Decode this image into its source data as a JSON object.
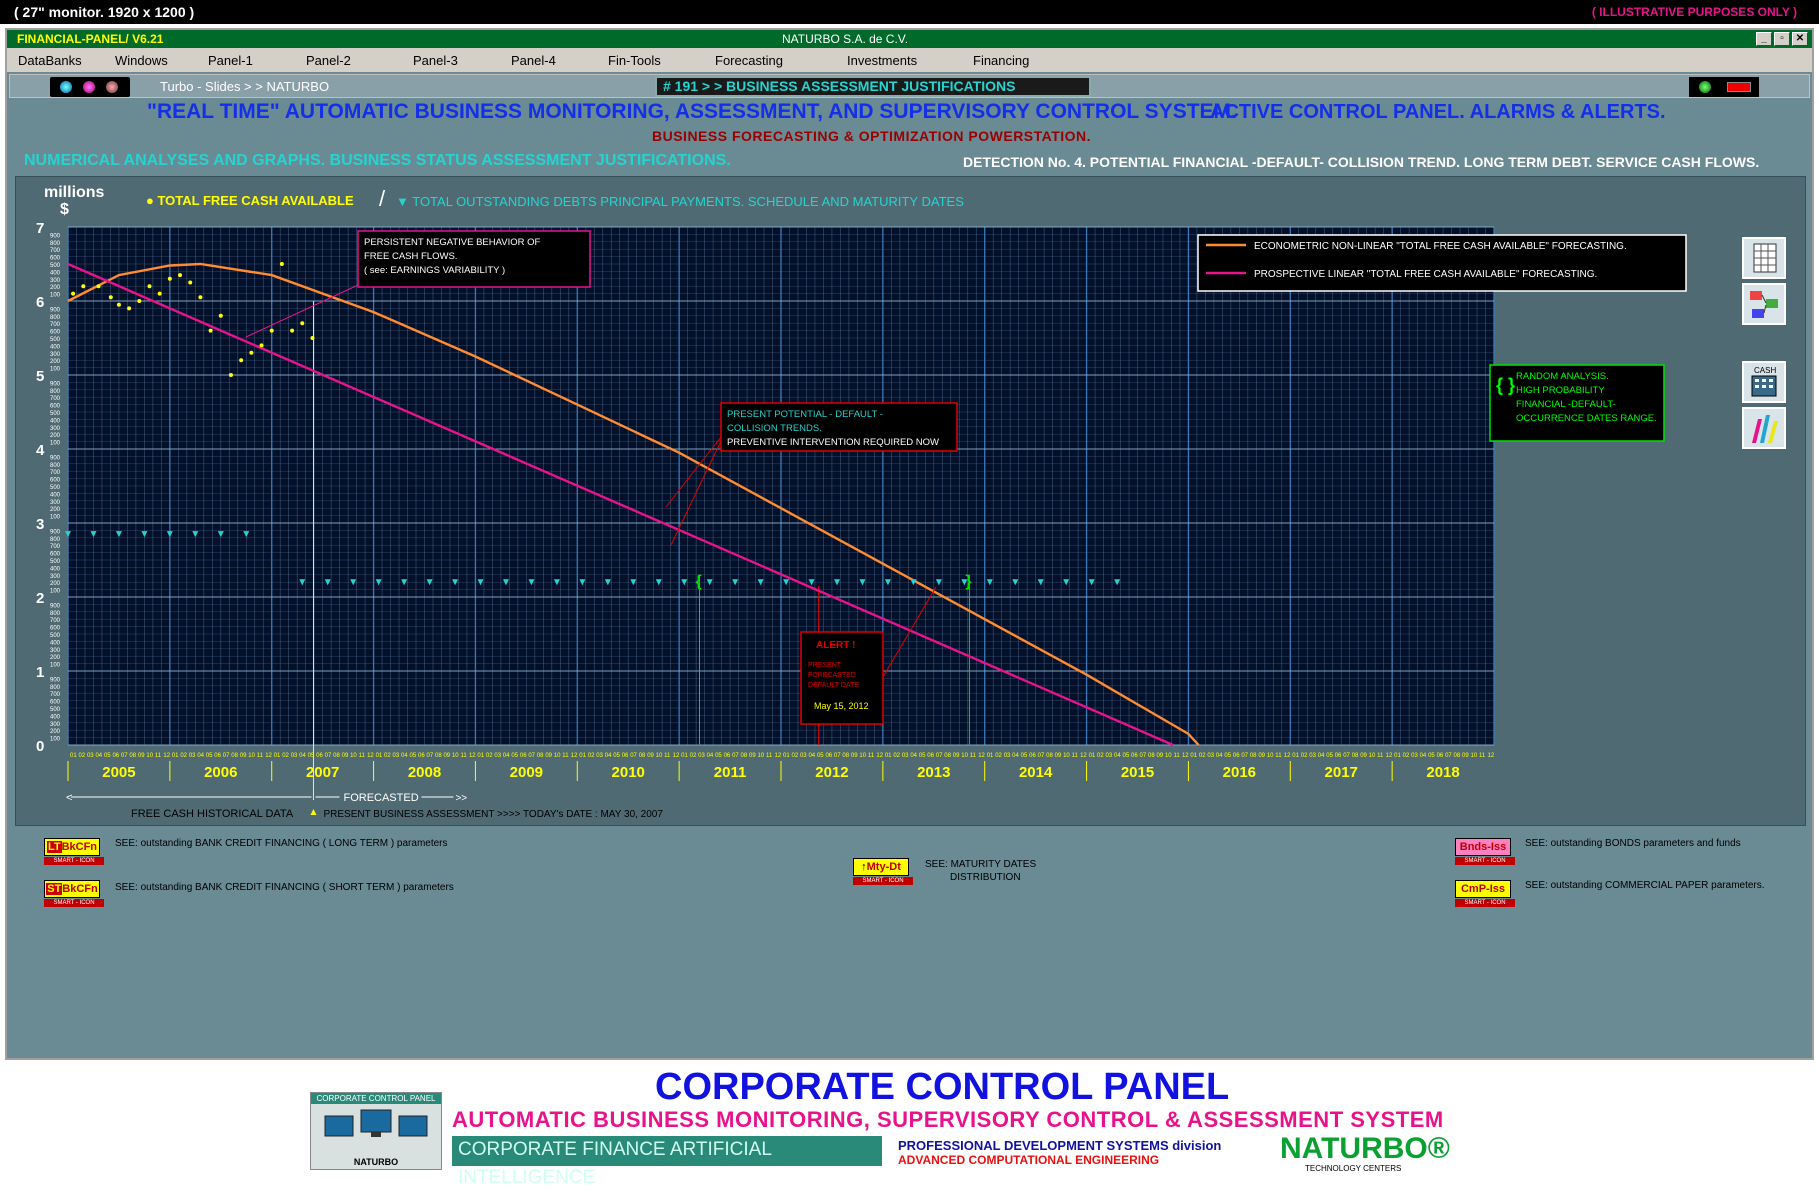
{
  "monitor": "( 27\" monitor.  1920 x 1200 )",
  "illustrative": "( ILLUSTRATIVE  PURPOSES  ONLY )",
  "app_title": "FINANCIAL-PANEL/ V6.21",
  "company": "NATURBO S.A.  de  C.V.",
  "menu": [
    "DataBanks",
    "Windows",
    "Panel-1",
    "Panel-2",
    "Panel-3",
    "Panel-4",
    "Fin-Tools",
    "Forecasting",
    "Investments",
    "Financing"
  ],
  "breadcrumb": "Turbo - Slides > > NATURBO",
  "slide_header": "# 191 > > BUSINESS ASSESSMENT JUSTIFICATIONS",
  "headline": "\"REAL TIME\"  AUTOMATIC  BUSINESS  MONITORING, ASSESSMENT, AND  SUPERVISORY  CONTROL  SYSTEM.",
  "headline2": "ACTIVE CONTROL PANEL.   ALARMS  &  ALERTS.",
  "subheadline": "BUSINESS  FORECASTING  &  OPTIMIZATION  POWERSTATION.",
  "section_left": "NUMERICAL ANALYSES AND GRAPHS.   BUSINESS STATUS ASSESSMENT JUSTIFICATIONS.",
  "section_right": "DETECTION No. 4.  POTENTIAL  FINANCIAL  -DEFAULT-  COLLISION TREND.  LONG TERM DEBT.  SERVICE CASH FLOWS.",
  "chart_labels": {
    "y_unit1": "millions",
    "y_unit2": "$",
    "legend1": "●  TOTAL  FREE  CASH  AVAILABLE",
    "legend2": "▼ TOTAL OUTSTANDING  DEBTS PRINCIPAL PAYMENTS.  SCHEDULE AND MATURITY DATES",
    "box_legend_orange": "ECONOMETRIC NON-LINEAR  \"TOTAL FREE CASH AVAILABLE\"  FORECASTING.",
    "box_legend_magenta": "PROSPECTIVE LINEAR  \"TOTAL FREE CASH AVAILABLE\"  FORECASTING.",
    "annot_negative": [
      "PERSISTENT NEGATIVE BEHAVIOR OF",
      "FREE  CASH  FLOWS.",
      "( see:  EARNINGS VARIABILITY )"
    ],
    "annot_collision": [
      "PRESENT  POTENTIAL  - DEFAULT -",
      "COLLISION  TRENDS.",
      "PREVENTIVE  INTERVENTION  REQUIRED  NOW"
    ],
    "annot_random": [
      "RANDOM  ANALYSIS.",
      "HIGH  PROBABILITY",
      "FINANCIAL  -DEFAULT-",
      "OCCURRENCE  DATES  RANGE."
    ],
    "annot_alert": [
      "ALERT   !",
      "PRESENT",
      "FORECASTED",
      "DEFAULT  DATE",
      "May 15, 2012"
    ],
    "hist_label": "FREE CASH HISTORICAL DATA",
    "forecast_label": "FORECASTED",
    "today_label": "PRESENT  BUSINESS  ASSESSMENT >>>> TODAY's  DATE :  MAY 30, 2007"
  },
  "chart_data": {
    "type": "line",
    "ylim": [
      0,
      7
    ],
    "y_ticks": [
      "0",
      "1",
      "2",
      "3",
      "4",
      "5",
      "6",
      "7"
    ],
    "years": [
      "2005",
      "2006",
      "2007",
      "2008",
      "2009",
      "2010",
      "2011",
      "2012",
      "2013",
      "2014",
      "2015",
      "2016",
      "2017",
      "2018"
    ],
    "series": [
      {
        "name": "ECONOMETRIC NON-LINEAR  \"TOTAL FREE CASH AVAILABLE\"  FORECASTING.",
        "color": "#ff8c32",
        "x": [
          2005.0,
          2005.5,
          2006.0,
          2006.3,
          2007.0,
          2008.0,
          2009.0,
          2010.0,
          2011.0,
          2012.0,
          2013.0,
          2014.0,
          2015.0,
          2016.0,
          2016.1
        ],
        "values": [
          6.0,
          6.35,
          6.48,
          6.5,
          6.35,
          5.85,
          5.25,
          4.6,
          3.95,
          3.2,
          2.45,
          1.7,
          0.95,
          0.15,
          0.0
        ]
      },
      {
        "name": "PROSPECTIVE LINEAR  \"TOTAL FREE CASH AVAILABLE\"  FORECASTING.",
        "color": "#e8138c",
        "x": [
          2005.0,
          2015.85
        ],
        "values": [
          6.5,
          0.0
        ]
      },
      {
        "name": "TOTAL FREE CASH AVAILABLE",
        "color": "#ffff00",
        "x": [
          2005.05,
          2005.15,
          2005.3,
          2005.42,
          2005.5,
          2005.6,
          2005.7,
          2005.8,
          2005.9,
          2006.0,
          2006.1,
          2006.2,
          2006.3,
          2006.4,
          2006.5,
          2006.6,
          2006.7,
          2006.8,
          2006.9,
          2007.0,
          2007.1,
          2007.2,
          2007.3,
          2007.4
        ],
        "values": [
          6.1,
          6.2,
          6.2,
          6.05,
          5.95,
          5.9,
          6.0,
          6.2,
          6.1,
          6.3,
          6.35,
          6.25,
          6.05,
          5.6,
          5.8,
          5.0,
          5.2,
          5.3,
          5.4,
          5.6,
          6.5,
          5.6,
          5.7,
          5.5
        ]
      },
      {
        "name": "TOTAL OUTSTANDING  DEBTS PRINCIPAL PAYMENTS",
        "color": "#25d4d0",
        "x": [
          2005.0,
          2005.25,
          2005.5,
          2005.75,
          2006.0,
          2006.25,
          2006.5,
          2006.75,
          2007.3,
          2007.55,
          2007.8,
          2008.05,
          2008.3,
          2008.55,
          2008.8,
          2009.05,
          2009.3,
          2009.55,
          2009.8,
          2010.05,
          2010.3,
          2010.55,
          2010.8,
          2011.05,
          2011.3,
          2011.55,
          2011.8,
          2012.05,
          2012.3,
          2012.55,
          2012.8,
          2013.05,
          2013.3,
          2013.55,
          2013.8,
          2014.05,
          2014.3,
          2014.55,
          2014.8,
          2015.05,
          2015.3
        ],
        "values": [
          2.85,
          2.85,
          2.85,
          2.85,
          2.85,
          2.85,
          2.85,
          2.85,
          2.2,
          2.2,
          2.2,
          2.2,
          2.2,
          2.2,
          2.2,
          2.2,
          2.2,
          2.2,
          2.2,
          2.2,
          2.2,
          2.2,
          2.2,
          2.2,
          2.2,
          2.2,
          2.2,
          2.2,
          2.2,
          2.2,
          2.2,
          2.2,
          2.2,
          2.2,
          2.2,
          2.2,
          2.2,
          2.2,
          2.2,
          2.2,
          2.2
        ]
      }
    ],
    "markers": {
      "today": 2007.41,
      "alert": 2012.37,
      "random_start": 2011.2,
      "random_end": 2013.85
    }
  },
  "bottom": {
    "lt_icon": "BkCFn",
    "lt_prefix": "LT",
    "lt_text": "SEE:  outstanding BANK CREDIT FINANCING  ( LONG TERM )  parameters",
    "st_icon": "BkCFn",
    "st_prefix": "ST",
    "st_text": "SEE:  outstanding BANK CREDIT FINANCING  ( SHORT TERM )  parameters",
    "mty_icon": "Mty-Dt",
    "mty_text1": "SEE: MATURITY DATES",
    "mty_text2": "DISTRIBUTION",
    "bnds_icon": "Bnds-Iss",
    "bnds_text": "SEE:  outstanding BONDS  parameters and funds",
    "cmp_icon": "CmP-Iss",
    "cmp_text": "SEE: outstanding COMMERCIAL PAPER parameters.",
    "smart_icon": "SMART - ICON"
  },
  "footer": {
    "title": "CORPORATE CONTROL PANEL",
    "subtitle": "AUTOMATIC  BUSINESS  MONITORING, SUPERVISORY CONTROL  &  ASSESSMENT  SYSTEM",
    "cfai": "CORPORATE FINANCE ARTIFICIAL INTELLIGENCE",
    "pds": "PROFESSIONAL DEVELOPMENT SYSTEMS division",
    "ace": "ADVANCED COMPUTATIONAL ENGINEERING",
    "brand": "NATURBO®",
    "tc": "TECHNOLOGY CENTERS",
    "logo_title": "CORPORATE CONTROL PANEL",
    "logo_brand": "NATURBO"
  }
}
